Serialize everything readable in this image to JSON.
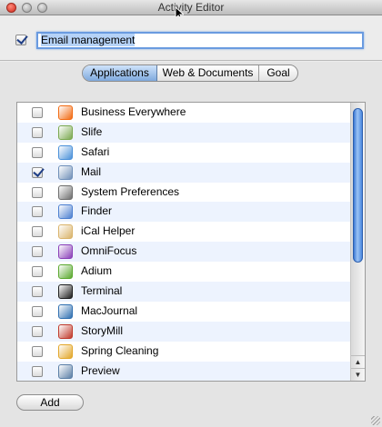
{
  "window": {
    "title": "Activity Editor"
  },
  "activity": {
    "enabled": true,
    "name": "Email management"
  },
  "tabs": [
    {
      "label": "Applications",
      "selected": true
    },
    {
      "label": "Web & Documents",
      "selected": false
    },
    {
      "label": "Goal",
      "selected": false
    }
  ],
  "applications": [
    {
      "label": "Business Everywhere",
      "checked": false,
      "icon": "business-everywhere-icon",
      "color": "#f26a12"
    },
    {
      "label": "Slife",
      "checked": false,
      "icon": "slife-icon",
      "color": "#7aa84f"
    },
    {
      "label": "Safari",
      "checked": false,
      "icon": "safari-icon",
      "color": "#4a90d9"
    },
    {
      "label": "Mail",
      "checked": true,
      "icon": "mail-icon",
      "color": "#6f8fb8"
    },
    {
      "label": "System Preferences",
      "checked": false,
      "icon": "system-preferences-icon",
      "color": "#6d6d6d"
    },
    {
      "label": "Finder",
      "checked": false,
      "icon": "finder-icon",
      "color": "#4c7fd0"
    },
    {
      "label": "iCal Helper",
      "checked": false,
      "icon": "ical-helper-icon",
      "color": "#d9b36a"
    },
    {
      "label": "OmniFocus",
      "checked": false,
      "icon": "omnifocus-icon",
      "color": "#8a3fb8"
    },
    {
      "label": "Adium",
      "checked": false,
      "icon": "adium-icon",
      "color": "#5aa82e"
    },
    {
      "label": "Terminal",
      "checked": false,
      "icon": "terminal-icon",
      "color": "#1e1e1e"
    },
    {
      "label": "MacJournal",
      "checked": false,
      "icon": "macjournal-icon",
      "color": "#2f6fb0"
    },
    {
      "label": "StoryMill",
      "checked": false,
      "icon": "storymill-icon",
      "color": "#c0392b"
    },
    {
      "label": "Spring Cleaning",
      "checked": false,
      "icon": "spring-cleaning-icon",
      "color": "#e2a629"
    },
    {
      "label": "Preview",
      "checked": false,
      "icon": "preview-icon",
      "color": "#5b7fa6"
    }
  ],
  "buttons": {
    "add_label": "Add"
  }
}
